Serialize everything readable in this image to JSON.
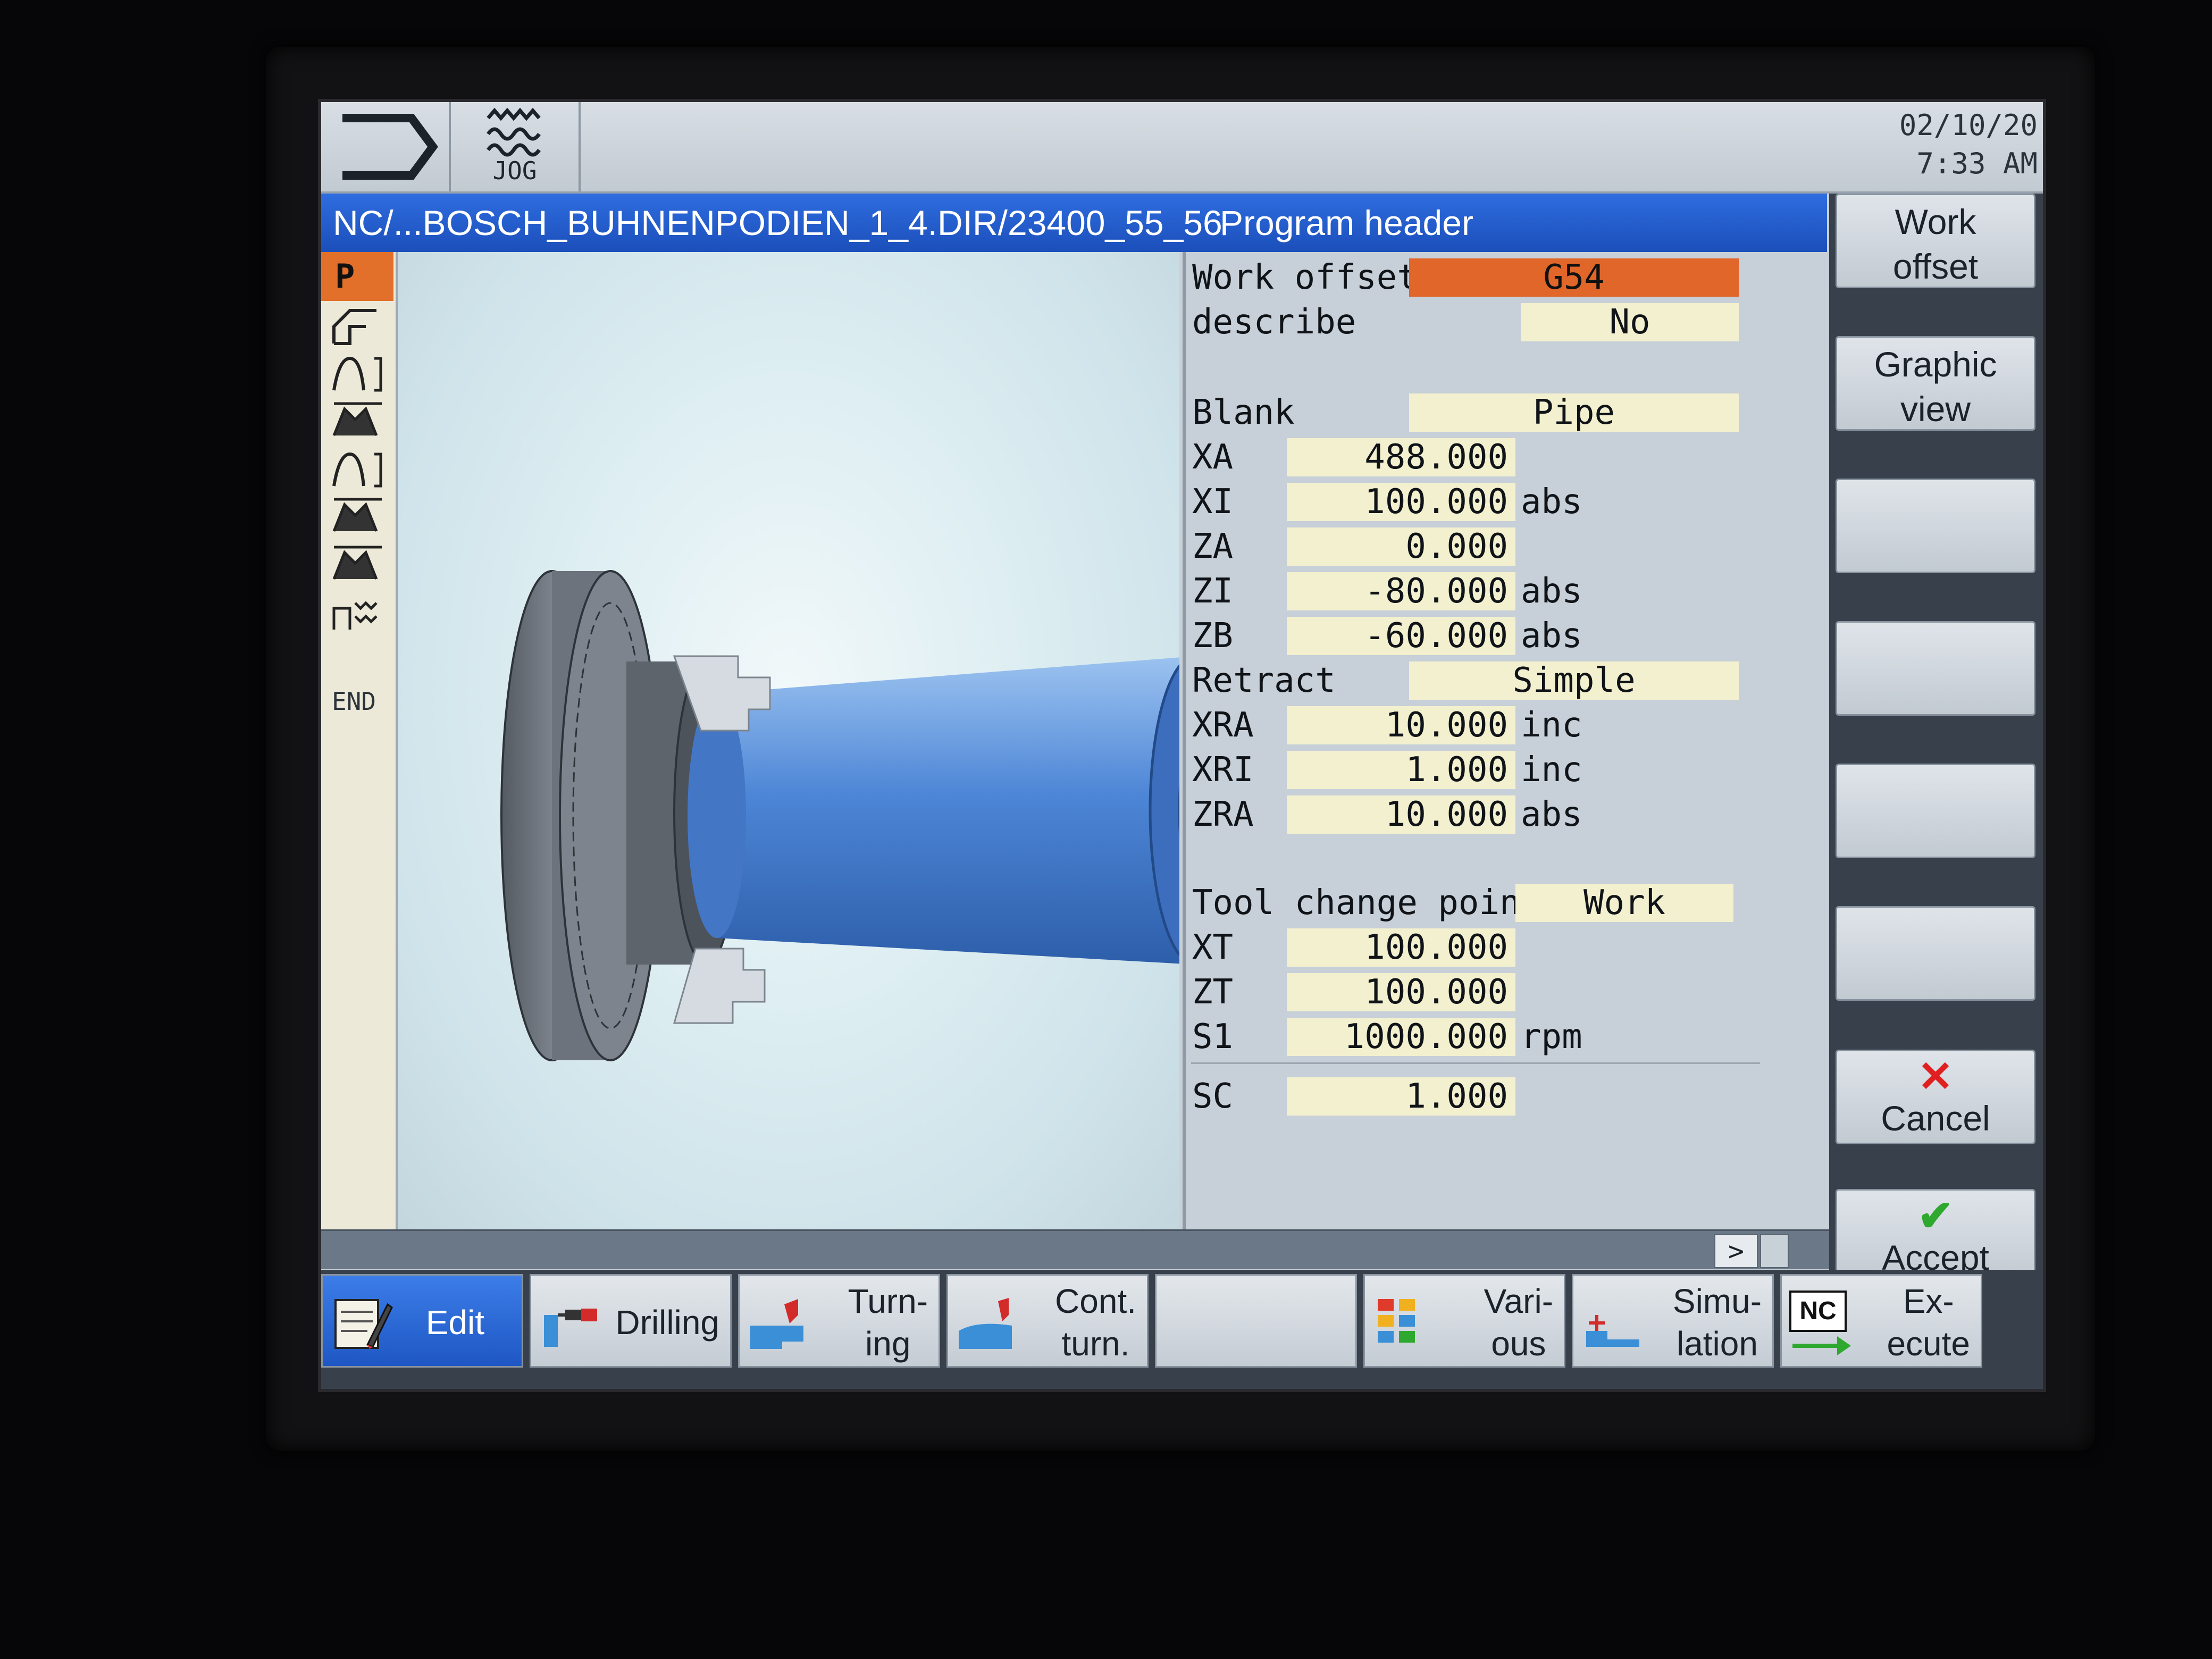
{
  "status": {
    "mode": "JOG",
    "date": "02/10/20",
    "time": "7:33 AM"
  },
  "title": {
    "path": "NC/...BOSCH_BUHNENPODIEN_1_4.DIR/23400_55_56",
    "section": "Program header"
  },
  "left_strip": {
    "first_item": "P",
    "end_label": "END"
  },
  "form": {
    "work_offset": {
      "label": "Work offset",
      "value": "G54"
    },
    "describe": {
      "label": "describe",
      "value": "No"
    },
    "blank": {
      "label": "Blank",
      "value": "Pipe"
    },
    "xa": {
      "label": "XA",
      "value": "488.000",
      "unit": ""
    },
    "xi": {
      "label": "XI",
      "value": "100.000",
      "unit": "abs"
    },
    "za": {
      "label": "ZA",
      "value": "0.000",
      "unit": ""
    },
    "zi": {
      "label": "ZI",
      "value": "-80.000",
      "unit": "abs"
    },
    "zb": {
      "label": "ZB",
      "value": "-60.000",
      "unit": "abs"
    },
    "retract": {
      "label": "Retract",
      "value": "Simple"
    },
    "xra": {
      "label": "XRA",
      "value": "10.000",
      "unit": "inc"
    },
    "xri": {
      "label": "XRI",
      "value": "1.000",
      "unit": "inc"
    },
    "zra": {
      "label": "ZRA",
      "value": "10.000",
      "unit": "abs"
    },
    "tool_change": {
      "label": "Tool change point",
      "value": "Work"
    },
    "xt": {
      "label": "XT",
      "value": "100.000",
      "unit": ""
    },
    "zt": {
      "label": "ZT",
      "value": "100.000",
      "unit": ""
    },
    "s1": {
      "label": "S1",
      "value": "1000.000",
      "unit": "rpm"
    },
    "sc": {
      "label": "SC",
      "value": "1.000",
      "unit": ""
    }
  },
  "vertical_softkeys": {
    "work_offset": {
      "line1": "Work",
      "line2": "offset"
    },
    "graphic_view": {
      "line1": "Graphic",
      "line2": "view"
    },
    "cancel": {
      "label": "Cancel",
      "icon": "x-icon",
      "color": "#e02020"
    },
    "accept": {
      "label": "Accept",
      "icon": "check-icon",
      "color": "#2fa82f"
    }
  },
  "scroll": {
    "more": ">"
  },
  "horizontal_softkeys": {
    "edit": {
      "line1": "Edit",
      "line2": ""
    },
    "drilling": {
      "line1": "Drilling",
      "line2": ""
    },
    "turning": {
      "line1": "Turn-",
      "line2": "ing"
    },
    "cont_turn": {
      "line1": "Cont.",
      "line2": "turn."
    },
    "various": {
      "line1": "Vari-",
      "line2": "ous"
    },
    "simulation": {
      "line1": "Simu-",
      "line2": "lation"
    },
    "execute": {
      "line1": "Ex-",
      "line2": "ecute",
      "badge": "NC"
    }
  },
  "colors": {
    "title_bar": "#1f58c8",
    "active_field": "#e0662a",
    "input_field": "#f3f0cf",
    "accent_blue": "#2a6ad8"
  }
}
